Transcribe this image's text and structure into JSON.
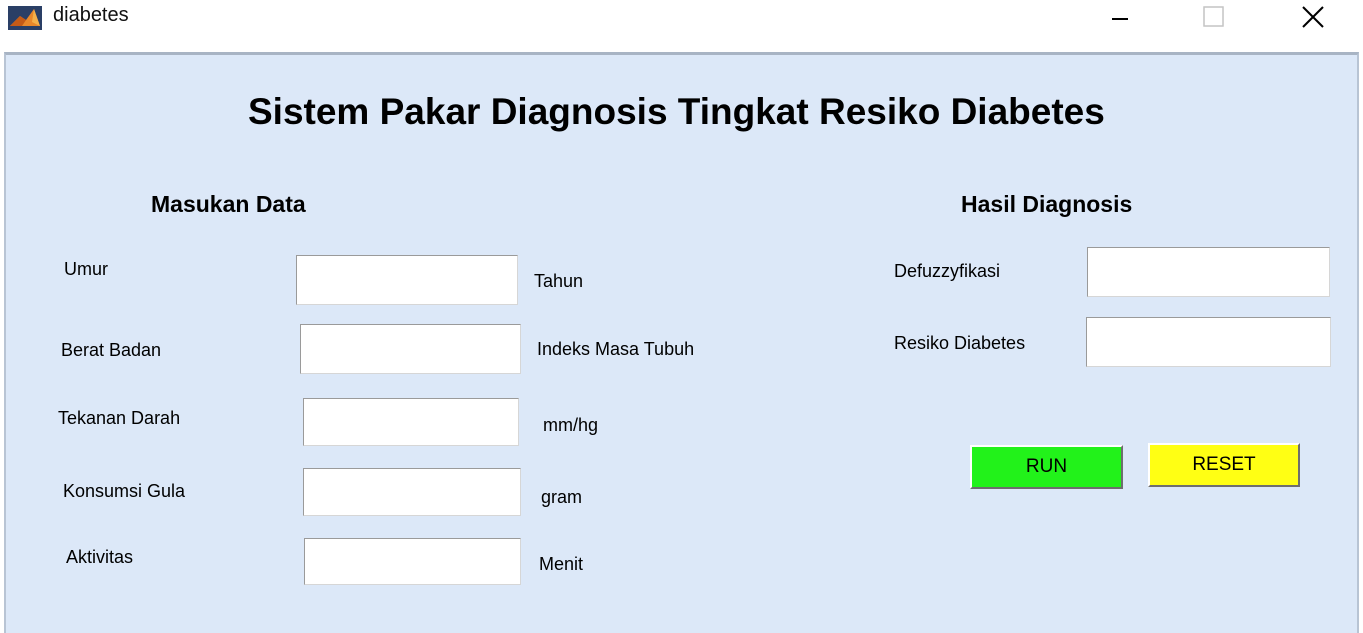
{
  "window": {
    "title": "diabetes",
    "controls": {
      "minimize_icon": "minimize-icon",
      "maximize_icon": "maximize-icon",
      "close_icon": "close-icon"
    }
  },
  "main": {
    "title": "Sistem Pakar Diagnosis Tingkat Resiko Diabetes"
  },
  "input_section": {
    "heading": "Masukan Data",
    "fields": [
      {
        "label": "Umur",
        "value": "",
        "unit": "Tahun"
      },
      {
        "label": "Berat Badan",
        "value": "",
        "unit": "Indeks Masa Tubuh"
      },
      {
        "label": "Tekanan Darah",
        "value": "",
        "unit": "mm/hg"
      },
      {
        "label": "Konsumsi Gula",
        "value": "",
        "unit": "gram"
      },
      {
        "label": "Aktivitas",
        "value": "",
        "unit": "Menit"
      }
    ]
  },
  "result_section": {
    "heading": "Hasil Diagnosis",
    "fields": [
      {
        "label": "Defuzzyfikasi",
        "value": ""
      },
      {
        "label": "Resiko Diabetes",
        "value": ""
      }
    ]
  },
  "buttons": {
    "run_label": "RUN",
    "reset_label": "RESET"
  },
  "colors": {
    "panel_background": "#dce8f8",
    "run_button": "#22f21a",
    "reset_button": "#ffff14"
  }
}
